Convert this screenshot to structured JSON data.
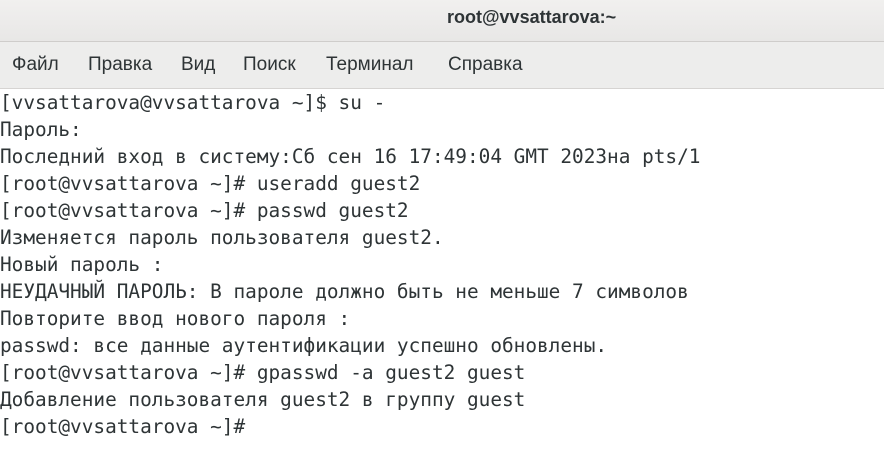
{
  "window": {
    "title": "root@vvsattarova:~"
  },
  "menubar": {
    "items": [
      "Файл",
      "Правка",
      "Вид",
      "Поиск",
      "Терминал",
      "Справка"
    ]
  },
  "terminal": {
    "lines": [
      "[vvsattarova@vvsattarova ~]$ su -",
      "Пароль:",
      "Последний вход в систему:Сб сен 16 17:49:04 GMT 2023на pts/1",
      "[root@vvsattarova ~]# useradd guest2",
      "[root@vvsattarova ~]# passwd guest2",
      "Изменяется пароль пользователя guest2.",
      "Новый пароль :",
      "НЕУДАЧНЫЙ ПАРОЛЬ: В пароле должно быть не меньше 7 символов",
      "Повторите ввод нового пароля :",
      "passwd: все данные аутентификации успешно обновлены.",
      "[root@vvsattarova ~]# gpasswd -a guest2 guest",
      "Добавление пользователя guest2 в группу guest",
      "[root@vvsattarova ~]#"
    ]
  }
}
